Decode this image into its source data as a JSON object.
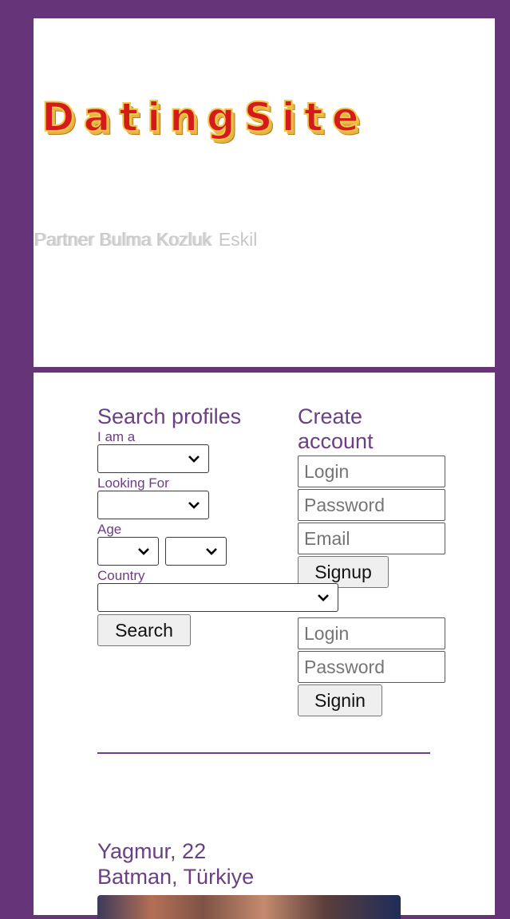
{
  "header": {
    "logo_text": "DatingSite",
    "tagline": "Partner Bulma Kozluk",
    "tagline_extra": "Eskil"
  },
  "search": {
    "title": "Search profiles",
    "iam_label": "I am a",
    "looking_for_label": "Looking For",
    "age_label": "Age",
    "country_label": "Country",
    "search_button": "Search"
  },
  "account": {
    "title": "Create account",
    "login_placeholder": "Login",
    "password_placeholder": "Password",
    "email_placeholder": "Email",
    "signup_button": "Signup"
  },
  "signin": {
    "login_placeholder": "Login",
    "password_placeholder": "Password",
    "signin_button": "Signin"
  },
  "profile": {
    "name_age": "Yagmur, 22",
    "location": "Batman, Türkiye"
  },
  "colors": {
    "background": "#663579",
    "accent_text": "#6a3f83",
    "logo_red": "#d41a1a",
    "logo_gold": "#f0c84a"
  }
}
